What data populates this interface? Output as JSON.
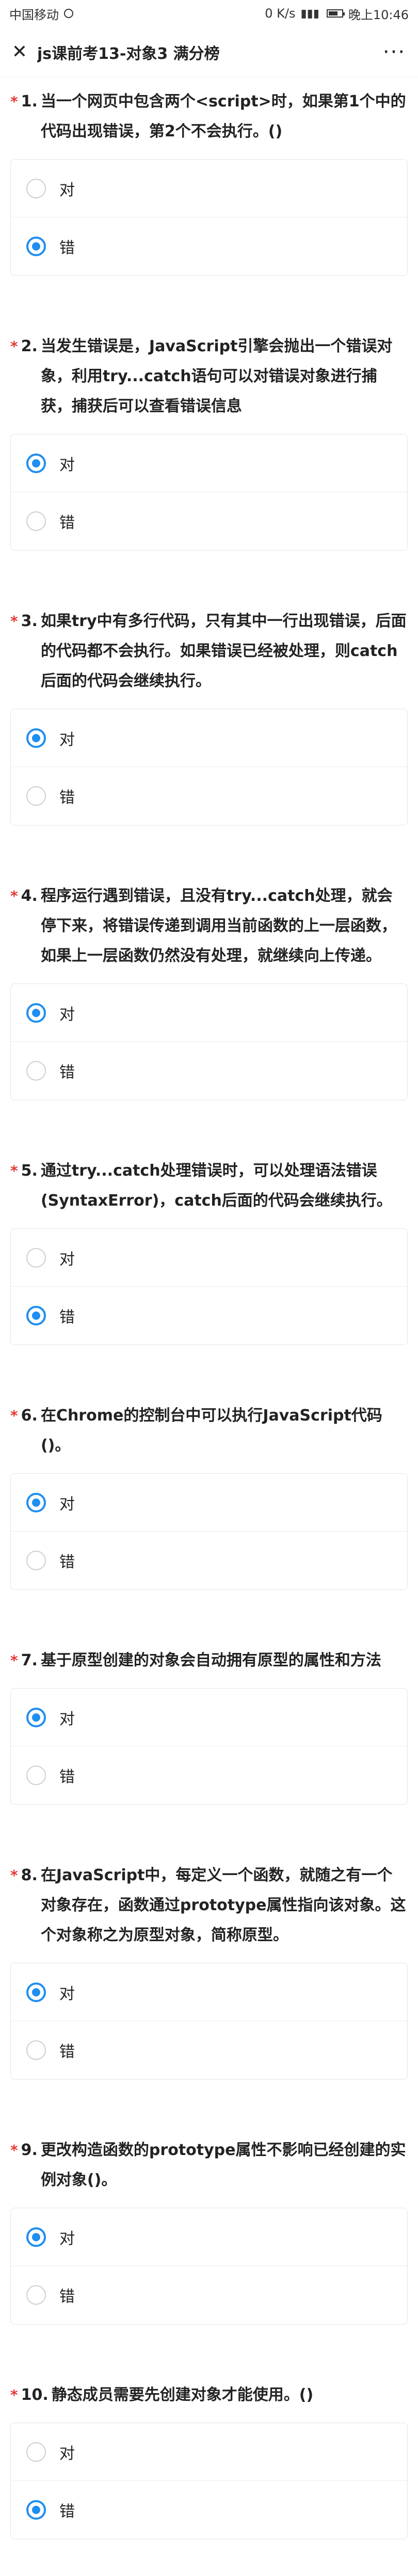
{
  "status_bar": {
    "carrier": "中国移动",
    "speed": "0 K/s",
    "time": "晚上10:46"
  },
  "header": {
    "title": "js课前考13-对象3 满分榜"
  },
  "questions": [
    {
      "number": "1.",
      "text": "当一个网页中包含两个<script>时，如果第1个中的代码出现错误，第2个不会执行。()",
      "options": [
        {
          "label": "对",
          "selected": false
        },
        {
          "label": "错",
          "selected": true
        }
      ]
    },
    {
      "number": "2.",
      "text": "当发生错误是，JavaScript引擎会抛出一个错误对象，利用try...catch语句可以对错误对象进行捕获，捕获后可以查看错误信息",
      "options": [
        {
          "label": "对",
          "selected": true
        },
        {
          "label": "错",
          "selected": false
        }
      ]
    },
    {
      "number": "3.",
      "text": "如果try中有多行代码，只有其中一行出现错误，后面的代码都不会执行。如果错误已经被处理，则catch后面的代码会继续执行。",
      "options": [
        {
          "label": "对",
          "selected": true
        },
        {
          "label": "错",
          "selected": false
        }
      ]
    },
    {
      "number": "4.",
      "text": "程序运行遇到错误，且没有try...catch处理，就会停下来，将错误传递到调用当前函数的上一层函数，如果上一层函数仍然没有处理，就继续向上传递。",
      "options": [
        {
          "label": "对",
          "selected": true
        },
        {
          "label": "错",
          "selected": false
        }
      ]
    },
    {
      "number": "5.",
      "text": "通过try...catch处理错误时，可以处理语法错误(SyntaxError)，catch后面的代码会继续执行。",
      "options": [
        {
          "label": "对",
          "selected": false
        },
        {
          "label": "错",
          "selected": true
        }
      ]
    },
    {
      "number": "6.",
      "text": "在Chrome的控制台中可以执行JavaScript代码()。",
      "options": [
        {
          "label": "对",
          "selected": true
        },
        {
          "label": "错",
          "selected": false
        }
      ]
    },
    {
      "number": "7.",
      "text": "基于原型创建的对象会自动拥有原型的属性和方法",
      "options": [
        {
          "label": "对",
          "selected": true
        },
        {
          "label": "错",
          "selected": false
        }
      ]
    },
    {
      "number": "8.",
      "text": "在JavaScript中，每定义一个函数，就随之有一个对象存在，函数通过prototype属性指向该对象。这个对象称之为原型对象，简称原型。",
      "options": [
        {
          "label": "对",
          "selected": true
        },
        {
          "label": "错",
          "selected": false
        }
      ]
    },
    {
      "number": "9.",
      "text": "更改构造函数的prototype属性不影响已经创建的实例对象()。",
      "options": [
        {
          "label": "对",
          "selected": true
        },
        {
          "label": "错",
          "selected": false
        }
      ]
    },
    {
      "number": "10.",
      "text": "静态成员需要先创建对象才能使用。()",
      "options": [
        {
          "label": "对",
          "selected": false
        },
        {
          "label": "错",
          "selected": true
        }
      ]
    }
  ],
  "colors": {
    "accent": "#1f8ef1",
    "required": "#e53935"
  },
  "icons": {
    "close": "close-icon",
    "more": "more-icon"
  }
}
